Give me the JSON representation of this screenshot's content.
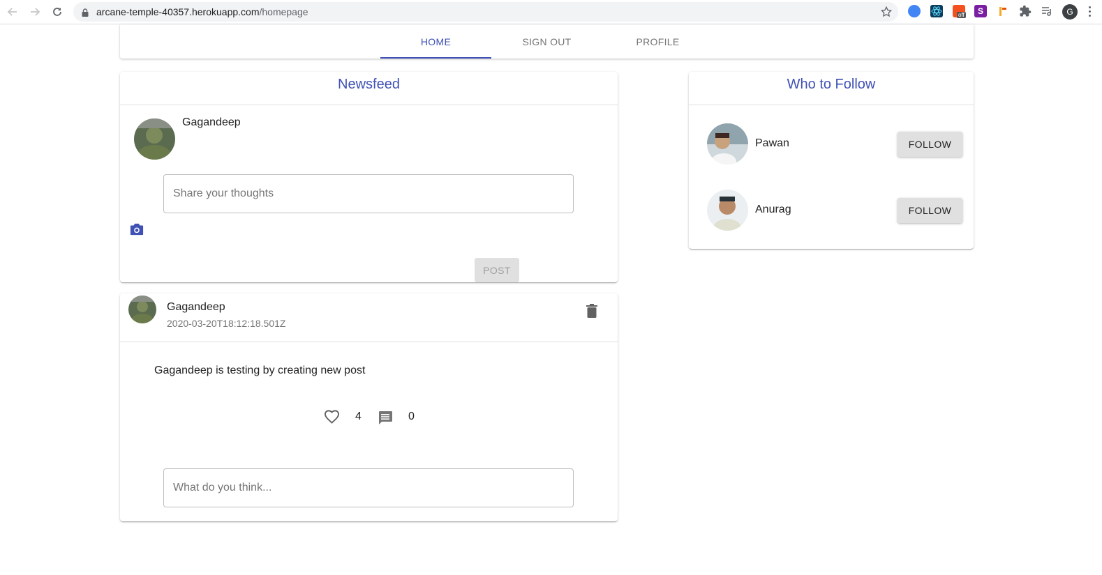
{
  "browser": {
    "url_host": "arcane-temple-40357.herokuapp.com",
    "url_path": "/homepage",
    "profile_initial": "G",
    "ext_badge": "off",
    "ext_letter": "S"
  },
  "tabs": [
    {
      "label": "Home",
      "active": true
    },
    {
      "label": "Sign out",
      "active": false
    },
    {
      "label": "Profile",
      "active": false
    }
  ],
  "newsfeed": {
    "title": "Newsfeed",
    "composer": {
      "user_name": "Gagandeep",
      "placeholder": "Share your thoughts",
      "post_label": "Post"
    },
    "posts": [
      {
        "user_name": "Gagandeep",
        "timestamp": "2020-03-20T18:12:18.501Z",
        "text": "Gagandeep is testing by creating new post",
        "likes": "4",
        "comments": "0",
        "comment_placeholder": "What do you think..."
      }
    ]
  },
  "who_to_follow": {
    "title": "Who to Follow",
    "users": [
      {
        "name": "Pawan",
        "button": "Follow"
      },
      {
        "name": "Anurag",
        "button": "Follow"
      }
    ]
  },
  "colors": {
    "primary": "#3f51b5",
    "icon_gray": "#616161"
  }
}
